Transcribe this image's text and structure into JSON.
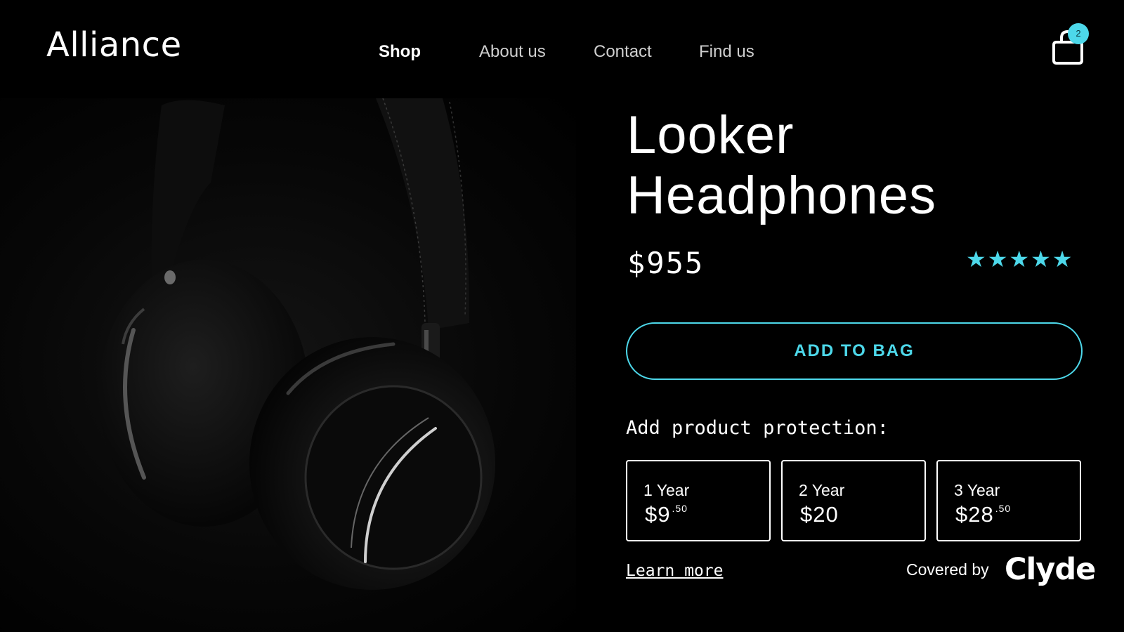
{
  "brand": {
    "logo": "Alliance"
  },
  "nav": {
    "items": [
      {
        "label": "Shop",
        "active": true
      },
      {
        "label": "About us",
        "active": false
      },
      {
        "label": "Contact",
        "active": false
      },
      {
        "label": "Find us",
        "active": false
      }
    ]
  },
  "cart": {
    "count": "2",
    "icon": "shopping-bag-icon"
  },
  "product": {
    "name_line1": "Looker",
    "name_line2": "Headphones",
    "price": "$955",
    "rating_stars": "★★★★★",
    "rating_value": 5
  },
  "actions": {
    "add_to_bag": "ADD TO BAG"
  },
  "protection": {
    "label": "Add product protection:",
    "plans": [
      {
        "term": "1 Year",
        "price": "$9",
        "cents": ".50"
      },
      {
        "term": "2 Year",
        "price": "$20",
        "cents": ""
      },
      {
        "term": "3 Year",
        "price": "$28",
        "cents": ".50"
      }
    ],
    "learn_more": "Learn more",
    "covered_by": "Covered by",
    "provider": "Clyde"
  },
  "colors": {
    "accent": "#4dd8ea",
    "background": "#000000",
    "text": "#ffffff"
  }
}
